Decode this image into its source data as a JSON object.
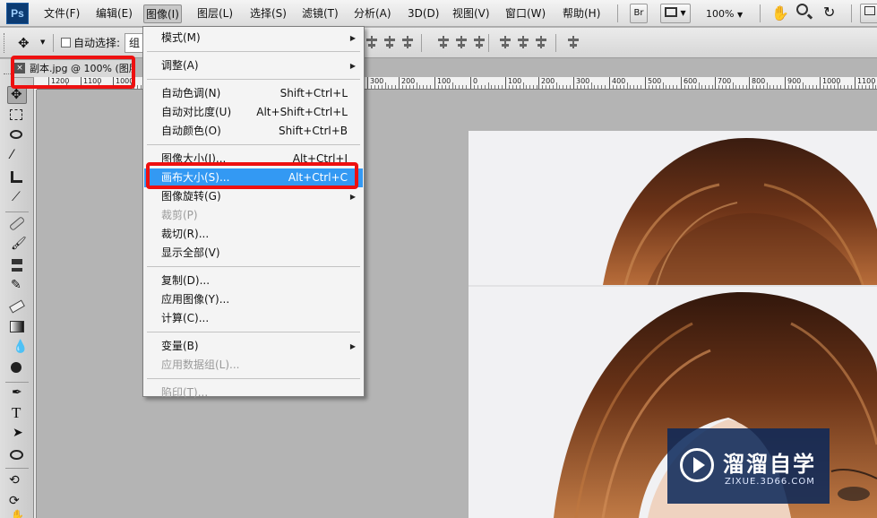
{
  "app": {
    "logo": "Ps"
  },
  "menubar": {
    "items": [
      "文件(F)",
      "编辑(E)",
      "图像(I)",
      "图层(L)",
      "选择(S)",
      "滤镜(T)",
      "分析(A)",
      "3D(D)",
      "视图(V)",
      "窗口(W)",
      "帮助(H)"
    ],
    "active_index": 2,
    "bridge": "Br",
    "zoom": "100%"
  },
  "options": {
    "auto_select_label": "自动选择:",
    "auto_select_value": "组"
  },
  "document": {
    "tab_title": "副本.jpg @ 100% (图层",
    "close": "×"
  },
  "ruler": {
    "ticks": [
      "1200",
      "1100",
      "1000",
      "300",
      "200",
      "100",
      "0",
      "100",
      "200",
      "300",
      "400",
      "500",
      "600",
      "700",
      "800",
      "900",
      "1000",
      "1100"
    ]
  },
  "image_menu": {
    "items": [
      {
        "label": "模式(M)",
        "shortcut": "",
        "submenu": true,
        "disabled": false
      },
      {
        "sep": true
      },
      {
        "label": "调整(A)",
        "shortcut": "",
        "submenu": true,
        "disabled": false
      },
      {
        "sep": true
      },
      {
        "label": "自动色调(N)",
        "shortcut": "Shift+Ctrl+L",
        "disabled": false
      },
      {
        "label": "自动对比度(U)",
        "shortcut": "Alt+Shift+Ctrl+L",
        "disabled": false
      },
      {
        "label": "自动颜色(O)",
        "shortcut": "Shift+Ctrl+B",
        "disabled": false
      },
      {
        "sep": true
      },
      {
        "label": "图像大小(I)...",
        "shortcut": "Alt+Ctrl+I",
        "disabled": false
      },
      {
        "label": "画布大小(S)...",
        "shortcut": "Alt+Ctrl+C",
        "disabled": false,
        "selected": true
      },
      {
        "label": "图像旋转(G)",
        "shortcut": "",
        "submenu": true,
        "disabled": false
      },
      {
        "label": "裁剪(P)",
        "shortcut": "",
        "disabled": true
      },
      {
        "label": "裁切(R)...",
        "shortcut": "",
        "disabled": false
      },
      {
        "label": "显示全部(V)",
        "shortcut": "",
        "disabled": false
      },
      {
        "sep": true
      },
      {
        "label": "复制(D)...",
        "shortcut": "",
        "disabled": false
      },
      {
        "label": "应用图像(Y)...",
        "shortcut": "",
        "disabled": false
      },
      {
        "label": "计算(C)...",
        "shortcut": "",
        "disabled": false
      },
      {
        "sep": true
      },
      {
        "label": "变量(B)",
        "shortcut": "",
        "submenu": true,
        "disabled": false
      },
      {
        "label": "应用数据组(L)...",
        "shortcut": "",
        "disabled": true
      },
      {
        "sep": true
      },
      {
        "label": "陷印(T)...",
        "shortcut": "",
        "disabled": true
      }
    ]
  },
  "watermark": {
    "brand": "溜溜自学",
    "url": "ZIXUE.3D66.COM"
  },
  "colors": {
    "highlight": "#ee1010",
    "menu_selected": "#3399f3",
    "watermark_bg": "#0a285a"
  }
}
